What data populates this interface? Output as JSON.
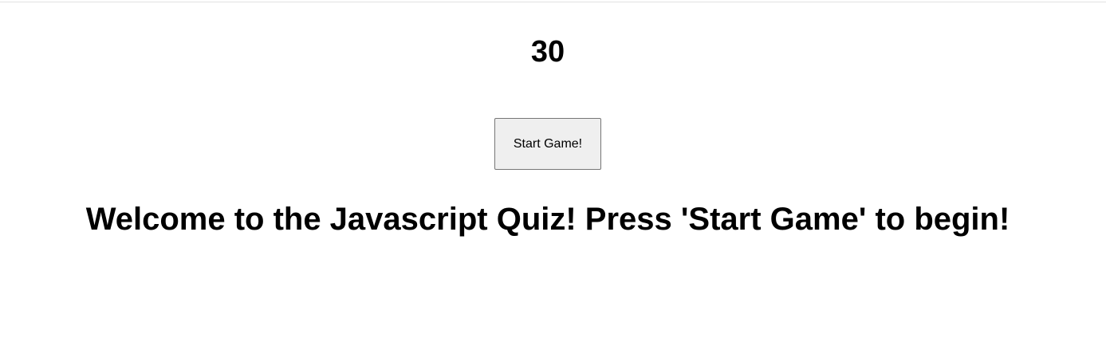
{
  "timer": {
    "value": "30"
  },
  "start_button": {
    "label": "Start Game!"
  },
  "welcome": {
    "message": "Welcome to the Javascript Quiz! Press 'Start Game' to begin!"
  },
  "colors": {
    "background": "#ffffff",
    "text": "#000000",
    "button_background": "#efefef",
    "button_border": "#767676",
    "top_rule": "#e2e2e2"
  }
}
